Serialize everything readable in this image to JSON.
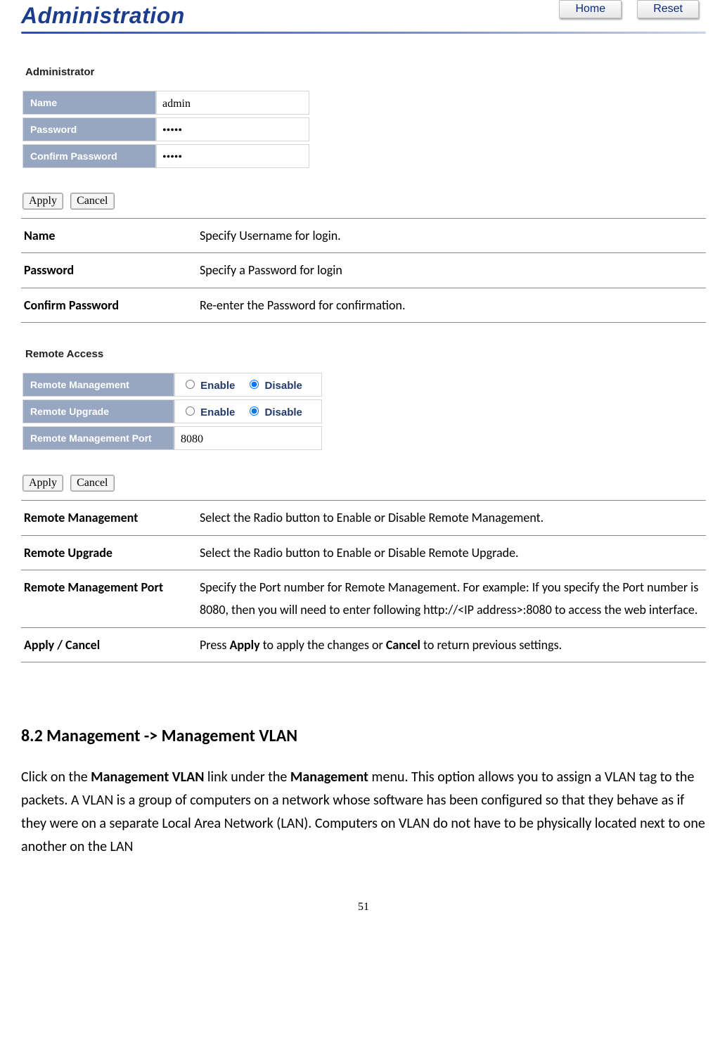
{
  "header": {
    "title": "Administration",
    "home": "Home",
    "reset": "Reset"
  },
  "admin_section": {
    "title": "Administrator",
    "rows": {
      "name_label": "Name",
      "name_value": "admin",
      "password_label": "Password",
      "password_value": "•••••",
      "confirm_label": "Confirm Password",
      "confirm_value": "•••••"
    }
  },
  "buttons": {
    "apply": "Apply",
    "cancel": "Cancel"
  },
  "admin_doc": [
    {
      "term": "Name",
      "desc": "Specify Username for login."
    },
    {
      "term": "Password",
      "desc": "Specify a Password for login"
    },
    {
      "term": "Confirm Password",
      "desc": "Re-enter the Password for confirmation."
    }
  ],
  "remote_section": {
    "title": "Remote Access",
    "mgmt_label": "Remote Management",
    "upgrade_label": "Remote Upgrade",
    "port_label": "Remote Management Port",
    "enable": "Enable",
    "disable": "Disable",
    "port_value": "8080"
  },
  "remote_doc": [
    {
      "term": "Remote Management",
      "desc": "Select the Radio button to Enable or Disable Remote Management."
    },
    {
      "term": "Remote Upgrade",
      "desc": "Select the Radio button to Enable or Disable Remote Upgrade."
    },
    {
      "term": "Remote Management Port",
      "desc": "Specify the Port number for Remote Management. For example: If you specify the Port number is 8080, then you will need to enter following http://<IP address>:8080 to access the web interface."
    },
    {
      "term": "Apply / Cancel",
      "desc_html": "Press <b>Apply</b> to apply the changes or <b>Cancel</b> to return previous settings."
    }
  ],
  "section_82": {
    "heading": "8.2 Management -> Management VLAN",
    "body_html": "Click on the <b>Management VLAN</b> link under the <b>Management</b> menu. This option allows you to assign a VLAN tag to the packets. A VLAN is a group of computers on a network whose software has been configured so that they behave as if they were on a separate Local Area Network (LAN). Computers on VLAN do not have to be physically located next to one another on the LAN"
  },
  "page_number": "51"
}
